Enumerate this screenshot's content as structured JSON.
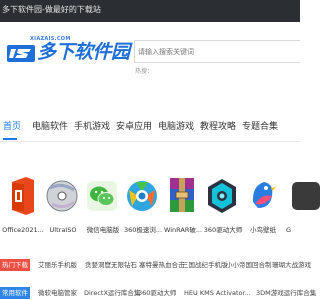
{
  "topbar": {
    "title": "多下软件园-做最好的下载站"
  },
  "logo": {
    "url_text": "XIAZAIS.COM",
    "mark_text": "XZ",
    "name": "多下软件园"
  },
  "search": {
    "placeholder": "请输入搜索关键词"
  },
  "hot_label": "热搜：",
  "nav": {
    "items": [
      "首页",
      "电脑软件",
      "手机游戏",
      "安卓应用",
      "电脑游戏",
      "教程攻略",
      "专题合集"
    ]
  },
  "apps": [
    {
      "name": "Office2021...",
      "icon": "office-icon"
    },
    {
      "name": "UltraISO",
      "icon": "ultraiso-icon"
    },
    {
      "name": "微信电脑版",
      "icon": "wechat-icon"
    },
    {
      "name": "360极速浏...",
      "icon": "360-browser-icon"
    },
    {
      "name": "WinRAR破...",
      "icon": "winrar-icon"
    },
    {
      "name": "360驱动大师",
      "icon": "360-driver-icon"
    },
    {
      "name": "小鸟壁纸",
      "icon": "bird-wallpaper-icon"
    },
    {
      "name": "G",
      "icon": "partial-app-icon"
    }
  ],
  "hot_downloads": {
    "tag": "热门下载",
    "items": [
      "艾丽乐手机版",
      "贪婪洞窟无限钻石",
      "塞特曼热血合击",
      "三国战纪手机版",
      "小小帝国回合制",
      "珊瑚大战游戏"
    ]
  },
  "common_software": {
    "tag": "常用软件",
    "items": [
      "微软电脑管家",
      "DirectX运行库合集",
      "360驱动大师",
      "HEU KMS Activator...",
      "3DM游戏运行库合集"
    ]
  },
  "colors": {
    "accent": "#1a7be8",
    "hot_tag": "#ef4e43",
    "common_tag": "#2f84e8",
    "topbar": "#2b2f33"
  }
}
